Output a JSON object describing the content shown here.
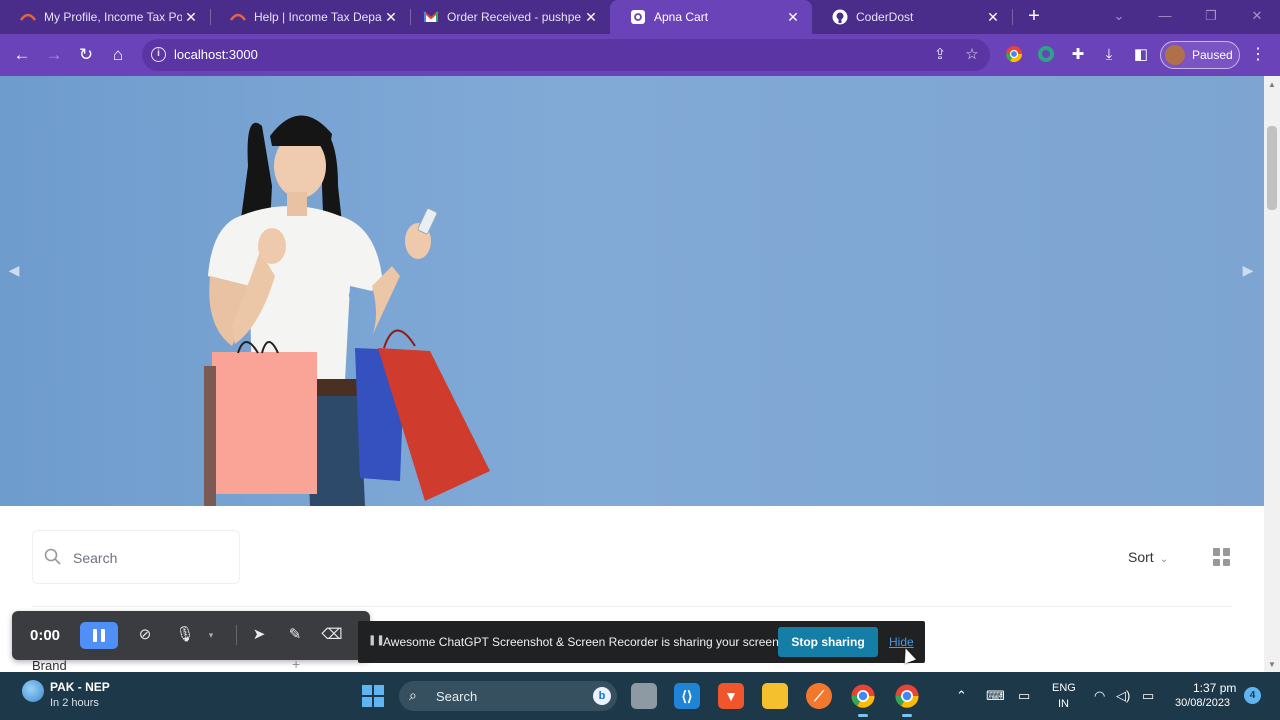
{
  "browser": {
    "tabs": [
      {
        "label": "My Profile, Income Tax Po",
        "favicon": "income-tax-icon"
      },
      {
        "label": "Help | Income Tax Depart",
        "favicon": "income-tax-icon"
      },
      {
        "label": "Order Received - pushpe",
        "favicon": "gmail-icon"
      },
      {
        "label": "Apna Cart",
        "favicon": "app-icon",
        "active": true
      },
      {
        "label": "CoderDost",
        "favicon": "github-icon"
      }
    ],
    "new_tab": "+",
    "url": "localhost:3000",
    "profile_status": "Paused",
    "accent_color": "#6b43b8"
  },
  "hero": {
    "prev_arrow": "◀",
    "next_arrow": "▶"
  },
  "filters": {
    "search_placeholder": "Search",
    "sort_label": "Sort",
    "brand_label": "Brand",
    "brand_expand": "+"
  },
  "recorder": {
    "time": "0:00"
  },
  "sharing": {
    "message": "Awesome ChatGPT Screenshot & Screen Recorder is sharing your screen.",
    "stop_label": "Stop sharing",
    "hide_label": "Hide"
  },
  "taskbar": {
    "weather_title": "PAK - NEP",
    "weather_sub": "In 2 hours",
    "search_label": "Search",
    "lang_line1": "ENG",
    "lang_line2": "IN",
    "time": "1:37 pm",
    "date": "30/08/2023",
    "notification_count": "4"
  }
}
